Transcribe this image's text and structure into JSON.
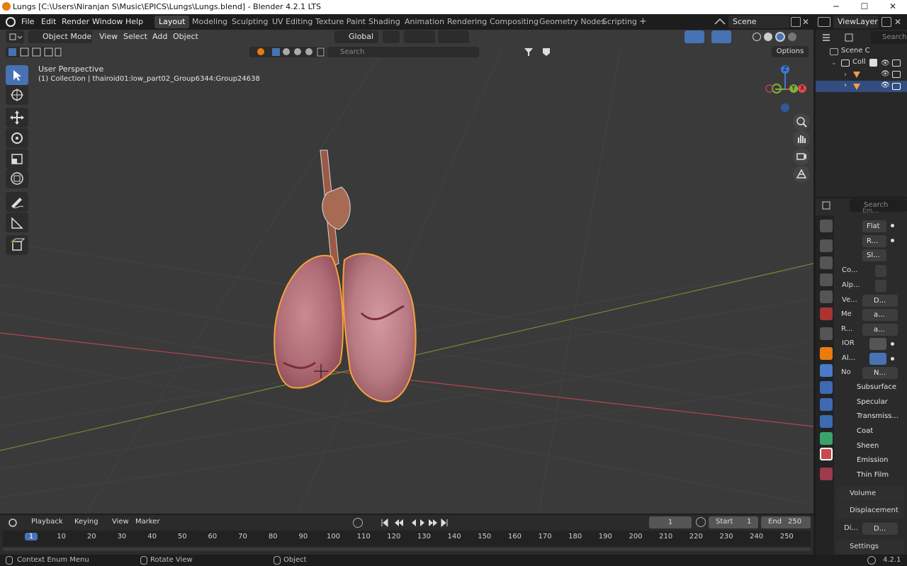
{
  "window": {
    "title": "Lungs [C:\\Users\\Niranjan S\\Music\\EPICS\\Lungs\\Lungs.blend] - Blender 4.2.1 LTS",
    "minimize": "─",
    "maximize": "☐",
    "close": "✕"
  },
  "menu": [
    "File",
    "Edit",
    "Render",
    "Window",
    "Help"
  ],
  "workspaces": [
    "Layout",
    "Modeling",
    "Sculpting",
    "UV Editing",
    "Texture Paint",
    "Shading",
    "Animation",
    "Rendering",
    "Compositing",
    "Geometry Nodes",
    "Scripting"
  ],
  "workspace_add": "+",
  "scene": {
    "label": "Scene",
    "view_layer": "ViewLayer"
  },
  "viewport_header": {
    "mode": "Object Mode",
    "menus": [
      "View",
      "Select",
      "Add",
      "Object"
    ],
    "orientation": "Global",
    "search_placeholder": "Search",
    "options": "Options"
  },
  "viewport": {
    "perspective": "User Perspective",
    "collection_info": "(1) Collection | thairoid01:low_part02_Group6344:Group24638",
    "gizmo": {
      "z": "Z",
      "y": "Y",
      "x": "X"
    }
  },
  "outliner": {
    "search_placeholder": "Search",
    "scene_label": "Scene C",
    "collection_label": "Coll"
  },
  "properties": {
    "search_placeholder": "Search",
    "top_clip": "Em...",
    "rows": [
      {
        "label": "",
        "value": "Flat"
      },
      {
        "label": "",
        "value": "R..."
      },
      {
        "label": "",
        "value": "Sl..."
      },
      {
        "label": "Co...",
        "value": ""
      },
      {
        "label": "Alp...",
        "value": ""
      },
      {
        "label": "Ve...",
        "value": "D..."
      },
      {
        "label": "Me",
        "value": "a..."
      },
      {
        "label": "R...",
        "value": "a..."
      },
      {
        "label": "IOR",
        "value": ""
      },
      {
        "label": "Al...",
        "value": ""
      },
      {
        "label": "No",
        "value": "N..."
      }
    ],
    "subsections": [
      "Subsurface",
      "Specular",
      "Transmiss...",
      "Coat",
      "Sheen",
      "Emission",
      "Thin Film"
    ],
    "sections": [
      "Volume",
      "Displacement"
    ],
    "displacement_row": {
      "label": "Di...",
      "value": "D..."
    },
    "settings": "Settings"
  },
  "timeline": {
    "menus": [
      "Playback",
      "Keying",
      "View",
      "Marker"
    ],
    "current_frame": "1",
    "start_label": "Start",
    "start": "1",
    "end_label": "End",
    "end": "250",
    "ruler": [
      "1",
      "10",
      "20",
      "30",
      "40",
      "50",
      "60",
      "70",
      "80",
      "90",
      "100",
      "110",
      "120",
      "130",
      "140",
      "150",
      "160",
      "170",
      "180",
      "190",
      "200",
      "210",
      "220",
      "230",
      "240",
      "250"
    ]
  },
  "statusbar": {
    "left": "Context Enum Menu",
    "middle": "Rotate View",
    "right": "Object",
    "version": "4.2.1"
  },
  "colors": {
    "accent": "#4772b3",
    "selection_outline": "#f4a23c",
    "axis_x": "#e04b4b",
    "axis_y": "#7db33a",
    "axis_z": "#3d7ad6"
  }
}
